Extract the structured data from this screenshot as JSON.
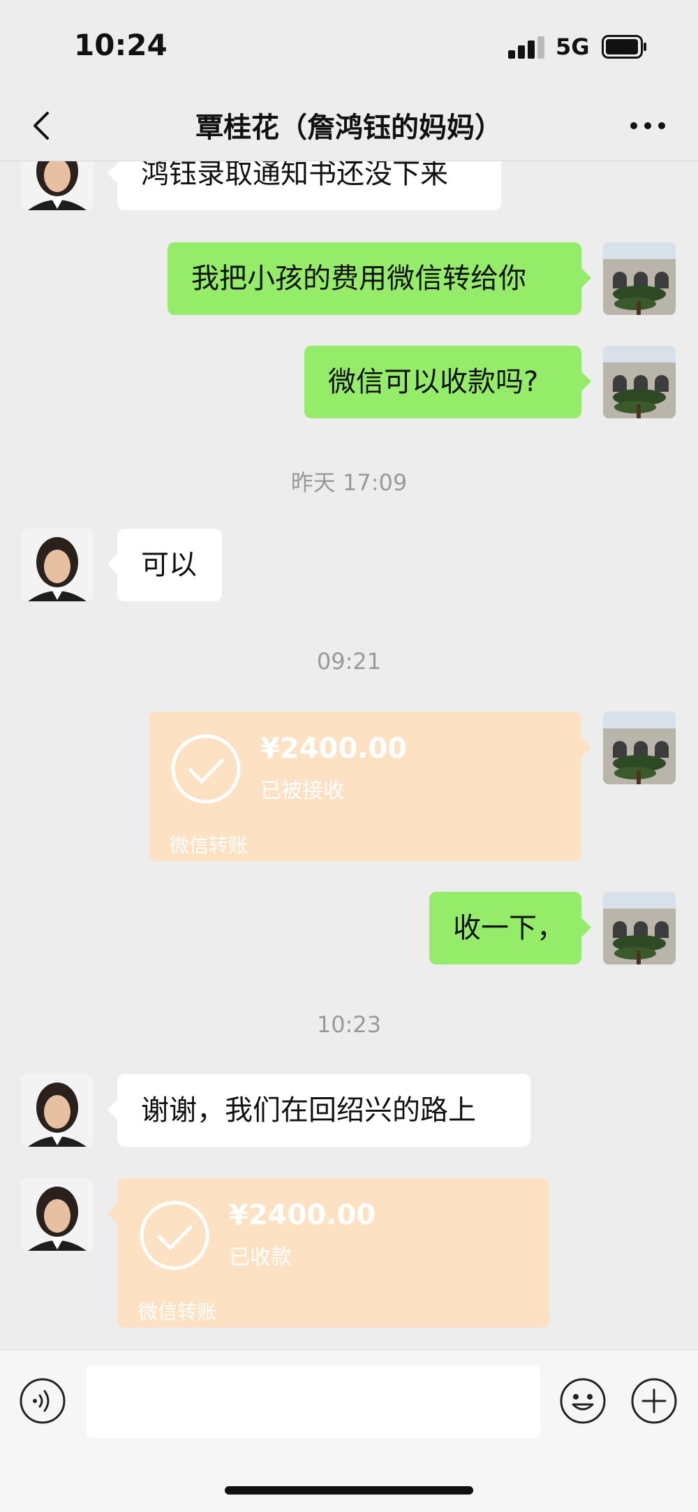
{
  "status_bar": {
    "time": "10:24",
    "network": "5G"
  },
  "header": {
    "title": "覃桂花（詹鸿钰的妈妈）"
  },
  "messages": [
    {
      "sender": "contact",
      "text": "鸿钰录取通知书还没下来"
    },
    {
      "sender": "me",
      "text": "我把小孩的费用微信转给你"
    },
    {
      "sender": "me",
      "text": "微信可以收款吗?"
    },
    {
      "type": "timestamp",
      "text": "昨天 17:09"
    },
    {
      "sender": "contact",
      "text": "可以"
    },
    {
      "type": "timestamp",
      "text": "09:21"
    },
    {
      "sender": "me",
      "type": "transfer",
      "amount": "¥2400.00",
      "status": "已被接收",
      "label": "微信转账"
    },
    {
      "sender": "me",
      "text": "收一下，"
    },
    {
      "type": "timestamp",
      "text": "10:23"
    },
    {
      "sender": "contact",
      "text": "谢谢，我们在回绍兴的路上"
    },
    {
      "sender": "contact",
      "type": "transfer",
      "amount": "¥2400.00",
      "status": "已收款",
      "label": "微信转账"
    }
  ],
  "input_bar": {
    "voice_icon": "voice-icon",
    "emoji_icon": "emoji-icon",
    "plus_icon": "plus-icon",
    "message_value": ""
  },
  "colors": {
    "background": "#ededed",
    "outgoing_bubble": "#95ec69",
    "incoming_bubble": "#ffffff",
    "transfer_card": "#fde1c3"
  }
}
